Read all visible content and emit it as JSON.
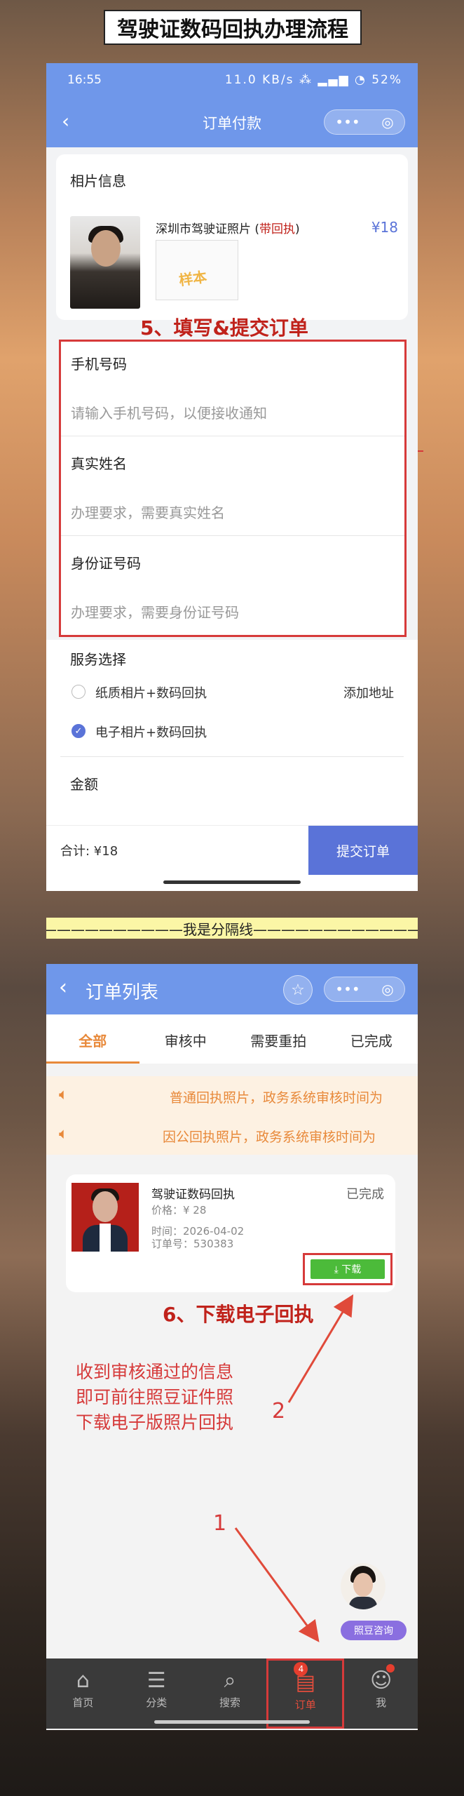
{
  "banner_title": "驾驶证数码回执办理流程",
  "screen1": {
    "status_time": "16:55",
    "status_right": "11.0 KB/s  ⁂ ▂▄▆ ◔ 52%",
    "nav_title": "订单付款",
    "photo_section_title": "相片信息",
    "product_name": "深圳市驾驶证照片 (",
    "product_name_highlight": "带回执",
    "product_name_end": ")",
    "product_price": "¥18",
    "sample_stamp": "样本",
    "step_label": "5、填写&提交订单",
    "fields": [
      {
        "label": "手机号码",
        "placeholder": "请输入手机号码，以便接收通知"
      },
      {
        "label": "真实姓名",
        "placeholder": "办理要求，需要真实姓名"
      },
      {
        "label": "身份证号码",
        "placeholder": "办理要求，需要身份证号码"
      }
    ],
    "service_title": "服务选择",
    "service_options": [
      {
        "label": "纸质相片+数码回执",
        "checked": false
      },
      {
        "label": "电子相片+数码回执",
        "checked": true
      }
    ],
    "add_address": "添加地址",
    "amount_title": "金额",
    "total_label": "合计: ¥18",
    "submit_label": "提交订单"
  },
  "divider_text": "———————————我是分隔线—————————————",
  "screen2": {
    "nav_title": "订单列表",
    "tabs": [
      "全部",
      "审核中",
      "需要重拍",
      "已完成"
    ],
    "active_tab": 0,
    "notices": [
      "普通回执照片，政务系统审核时间为",
      "因公回执照片，政务系统审核时间为"
    ],
    "order": {
      "title": "驾驶证数码回执",
      "status": "已完成",
      "price": "价格：¥ 28",
      "time": "时间：2026-04-02",
      "order_no": "订单号：530383",
      "download_label": "⤓ 下载"
    },
    "step_label": "6、下载电子回执",
    "instruction": [
      "收到审核通过的信息",
      "即可前往照豆证件照",
      "下载电子版照片回执"
    ],
    "num1": "1",
    "num2": "2",
    "consult_label": "照豆咨询",
    "tabbar": [
      {
        "label": "首页",
        "icon": "home-icon"
      },
      {
        "label": "分类",
        "icon": "category-icon"
      },
      {
        "label": "搜索",
        "icon": "search-icon"
      },
      {
        "label": "订单",
        "icon": "order-icon",
        "badge": "4"
      },
      {
        "label": "我",
        "icon": "user-icon"
      }
    ]
  }
}
